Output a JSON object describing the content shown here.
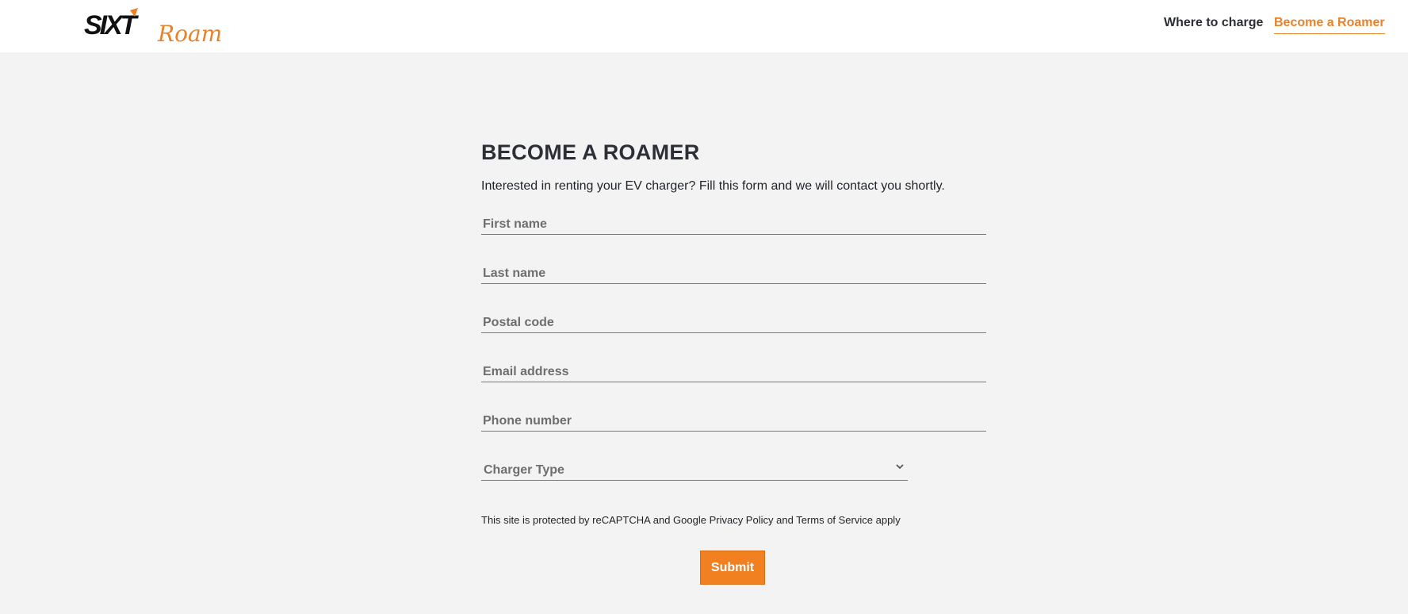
{
  "header": {
    "logo": {
      "brand": "SIXT",
      "product": "Roam"
    },
    "nav": {
      "where_to_charge": "Where to charge",
      "become_roamer": "Become a Roamer"
    }
  },
  "colors": {
    "accent": "#f08020",
    "page_bg": "#f3f3f3",
    "header_bg": "#ffffff",
    "title": "#2b2f36"
  },
  "form": {
    "title": "BECOME A ROAMER",
    "intro": "Interested in renting your EV charger? Fill this form and we will contact you shortly.",
    "fields": {
      "first_name": {
        "placeholder": "First name",
        "value": ""
      },
      "last_name": {
        "placeholder": "Last name",
        "value": ""
      },
      "postal_code": {
        "placeholder": "Postal code",
        "value": ""
      },
      "email": {
        "placeholder": "Email address",
        "value": ""
      },
      "phone": {
        "placeholder": "Phone number",
        "value": ""
      }
    },
    "charger_type": {
      "label": "Charger Type",
      "icon": "chevron-down-icon"
    },
    "recaptcha": {
      "prefix": "This site is protected by reCAPTCHA and Google ",
      "privacy_link": "Privacy Policy",
      "and": " and ",
      "terms_link": "Terms of Service",
      "suffix": " apply"
    },
    "submit_label": "Submit"
  }
}
